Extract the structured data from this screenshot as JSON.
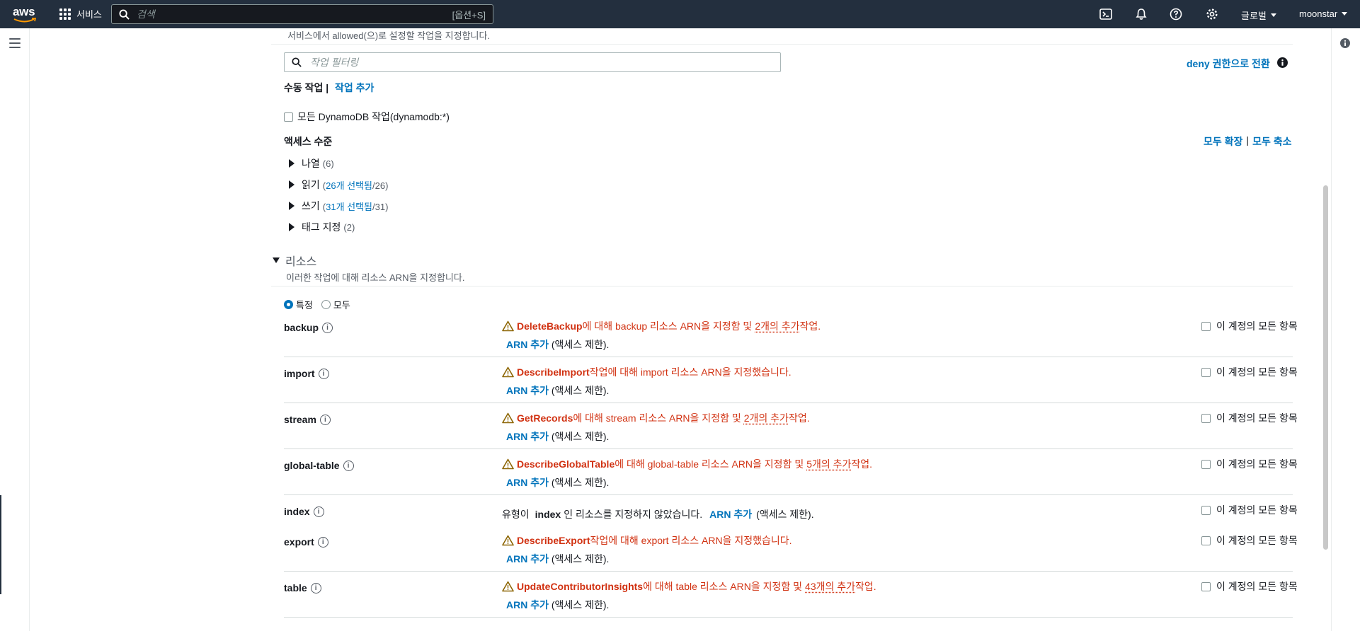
{
  "nav": {
    "logo": "aws",
    "services_label": "서비스",
    "search_placeholder": "검색",
    "search_shortcut": "[옵션+S]",
    "region": "글로벌",
    "account": "moonstar"
  },
  "section_actions": {
    "description": "서비스에서 allowed(으)로 설정할 작업을 지정합니다.",
    "filter_placeholder": "작업 필터링",
    "switch_deny": "deny 권한으로 전환",
    "manual_label": "수동 작업 |",
    "add_action": "작업 추가",
    "all_actions_label": "모든 DynamoDB 작업(dynamodb:*)",
    "access_level_title": "액세스 수준",
    "expand_all": "모두 확장",
    "separator": "|",
    "collapse_all": "모두 축소",
    "levels": [
      {
        "label": "나열",
        "count_prefix": "(6)",
        "selected": "",
        "total": ""
      },
      {
        "label": "읽기",
        "count_prefix": "(",
        "selected": "26개 선택됨",
        "total": "/26)"
      },
      {
        "label": "쓰기",
        "count_prefix": "(",
        "selected": "31개 선택됨",
        "total": "/31)"
      },
      {
        "label": "태그 지정",
        "count_prefix": "(2)",
        "selected": "",
        "total": ""
      }
    ]
  },
  "section_resources": {
    "title": "리소스",
    "description": "이러한 작업에 대해 리소스 ARN을 지정합니다.",
    "radio_specific": "특정",
    "radio_all": "모두",
    "all_in_account": "이 계정의 모든 항목",
    "arn_add": "ARN 추가",
    "arn_suffix": "(액세스 제한).",
    "rows": [
      {
        "name": "backup",
        "action": "DeleteBackup",
        "middle": "에 대해 backup 리소스 ARN을 지정함  및 ",
        "more": "2개의 추가",
        "end": " 작업."
      },
      {
        "name": "import",
        "action": "DescribeImport",
        "middle": " 작업에 대해 import 리소스 ARN을 지정했습니다.",
        "more": "",
        "end": ""
      },
      {
        "name": "stream",
        "action": "GetRecords",
        "middle": "에 대해 stream 리소스 ARN을 지정함  및 ",
        "more": "2개의 추가",
        "end": " 작업."
      },
      {
        "name": "global-table",
        "action": "DescribeGlobalTable",
        "middle": "에 대해 global-table 리소스 ARN을 지정함  및 ",
        "more": "5개의 추가",
        "end": " 작업."
      },
      {
        "name": "index",
        "plain_prefix": "유형이 ",
        "plain_type": "index",
        "plain_suffix": "인 리소스를 지정하지 않았습니다."
      },
      {
        "name": "export",
        "action": "DescribeExport",
        "middle": " 작업에 대해 export 리소스 ARN을 지정했습니다.",
        "more": "",
        "end": ""
      },
      {
        "name": "table",
        "action": "UpdateContributorInsights",
        "middle": "에 대해 table 리소스 ARN을 지정함  및 ",
        "more": "43개의 추가",
        "end": " 작업."
      }
    ]
  },
  "colors": {
    "nav_bg": "#232f3e",
    "link": "#0073bb",
    "error": "#d13212",
    "warning_icon": "#8d6605"
  }
}
